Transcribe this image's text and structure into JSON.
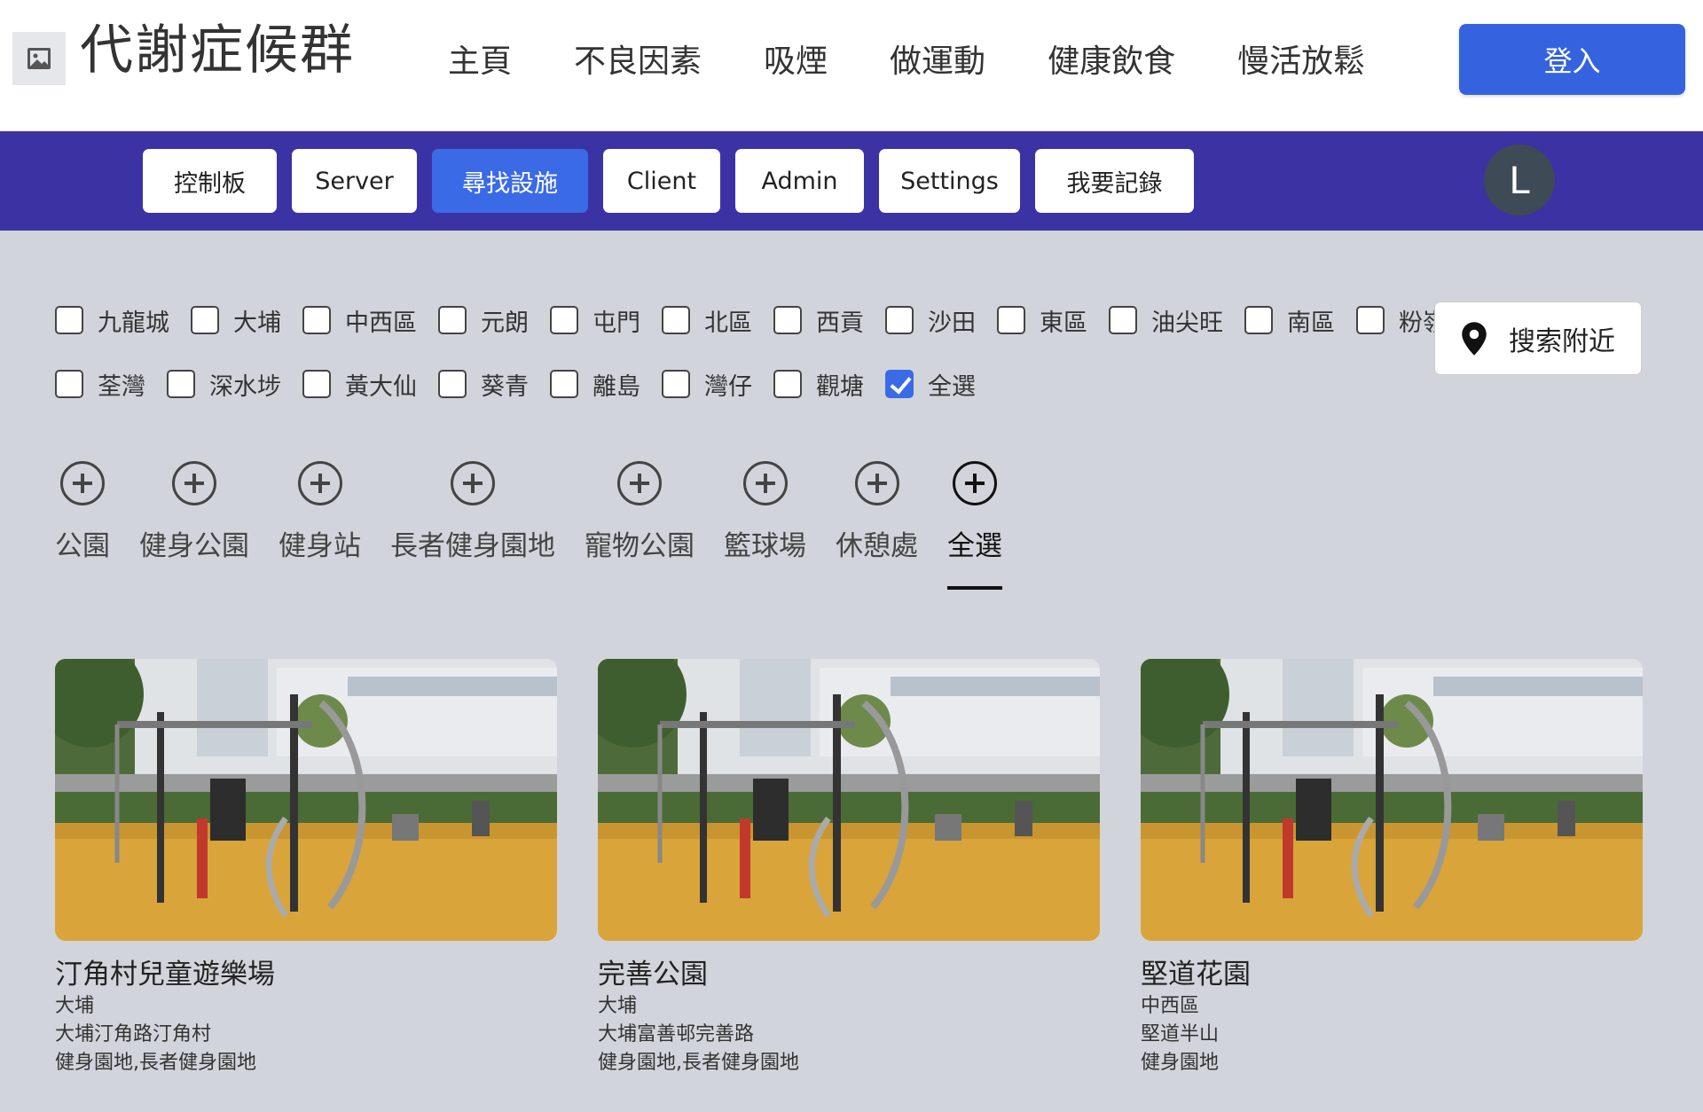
{
  "header": {
    "brand": "代謝症候群",
    "nav": [
      "主頁",
      "不良因素",
      "吸煙",
      "做運動",
      "健康飲食",
      "慢活放鬆"
    ],
    "login": "登入",
    "logo_icon": "image-icon"
  },
  "subnav": {
    "tabs": [
      "控制板",
      "Server",
      "尋找設施",
      "Client",
      "Admin",
      "Settings",
      "我要記錄"
    ],
    "active_tab": "尋找設施",
    "avatar": "L",
    "bar_color": "#3b33a3",
    "accent": "#3b6ae6"
  },
  "districts": {
    "row1": [
      "九龍城",
      "大埔",
      "中西區",
      "元朗",
      "屯門",
      "北區",
      "西貢",
      "沙田",
      "東區",
      "油尖旺",
      "南區",
      "粉嶺"
    ],
    "row2": [
      "荃灣",
      "深水埗",
      "黃大仙",
      "葵青",
      "離島",
      "灣仔",
      "觀塘",
      "全選"
    ],
    "checked": [
      "全選"
    ]
  },
  "search_near": {
    "label": "搜索附近",
    "icon": "location-pin-icon"
  },
  "facility_types": {
    "items": [
      "公園",
      "健身公園",
      "健身站",
      "長者健身園地",
      "寵物公園",
      "籃球場",
      "休憩處",
      "全選"
    ],
    "active": "全選",
    "icon": "plus-circle-icon"
  },
  "cards": [
    {
      "title": "汀角村兒童遊樂場",
      "district": "大埔",
      "address": "大埔汀角路汀角村",
      "facilities": "健身園地,長者健身園地"
    },
    {
      "title": "完善公園",
      "district": "大埔",
      "address": "大埔富善邨完善路",
      "facilities": "健身園地,長者健身園地"
    },
    {
      "title": "堅道花園",
      "district": "中西區",
      "address": "堅道半山",
      "facilities": "健身園地"
    }
  ]
}
